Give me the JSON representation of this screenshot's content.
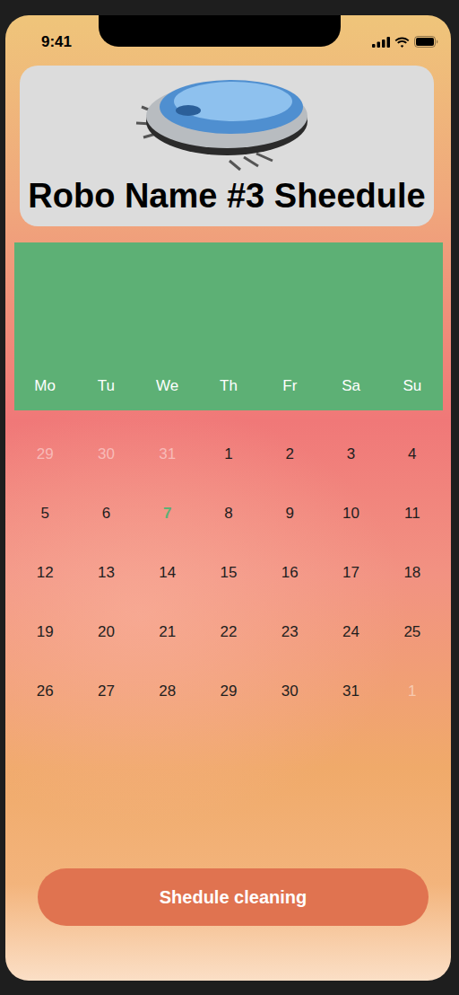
{
  "status_bar": {
    "time": "9:41"
  },
  "header": {
    "title": "Robo Name #3 Sheedule"
  },
  "calendar": {
    "weekdays": [
      "Mo",
      "Tu",
      "We",
      "Th",
      "Fr",
      "Sa",
      "Su"
    ],
    "days": [
      {
        "label": "29",
        "muted": true,
        "selected": false
      },
      {
        "label": "30",
        "muted": true,
        "selected": false
      },
      {
        "label": "31",
        "muted": true,
        "selected": false
      },
      {
        "label": "1",
        "muted": false,
        "selected": false
      },
      {
        "label": "2",
        "muted": false,
        "selected": false
      },
      {
        "label": "3",
        "muted": false,
        "selected": false
      },
      {
        "label": "4",
        "muted": false,
        "selected": false
      },
      {
        "label": "5",
        "muted": false,
        "selected": false
      },
      {
        "label": "6",
        "muted": false,
        "selected": false
      },
      {
        "label": "7",
        "muted": false,
        "selected": true
      },
      {
        "label": "8",
        "muted": false,
        "selected": false
      },
      {
        "label": "9",
        "muted": false,
        "selected": false
      },
      {
        "label": "10",
        "muted": false,
        "selected": false
      },
      {
        "label": "11",
        "muted": false,
        "selected": false
      },
      {
        "label": "12",
        "muted": false,
        "selected": false
      },
      {
        "label": "13",
        "muted": false,
        "selected": false
      },
      {
        "label": "14",
        "muted": false,
        "selected": false
      },
      {
        "label": "15",
        "muted": false,
        "selected": false
      },
      {
        "label": "16",
        "muted": false,
        "selected": false
      },
      {
        "label": "17",
        "muted": false,
        "selected": false
      },
      {
        "label": "18",
        "muted": false,
        "selected": false
      },
      {
        "label": "19",
        "muted": false,
        "selected": false
      },
      {
        "label": "20",
        "muted": false,
        "selected": false
      },
      {
        "label": "21",
        "muted": false,
        "selected": false
      },
      {
        "label": "22",
        "muted": false,
        "selected": false
      },
      {
        "label": "23",
        "muted": false,
        "selected": false
      },
      {
        "label": "24",
        "muted": false,
        "selected": false
      },
      {
        "label": "25",
        "muted": false,
        "selected": false
      },
      {
        "label": "26",
        "muted": false,
        "selected": false
      },
      {
        "label": "27",
        "muted": false,
        "selected": false
      },
      {
        "label": "28",
        "muted": false,
        "selected": false
      },
      {
        "label": "29",
        "muted": false,
        "selected": false
      },
      {
        "label": "30",
        "muted": false,
        "selected": false
      },
      {
        "label": "31",
        "muted": false,
        "selected": false
      },
      {
        "label": "1",
        "muted": true,
        "selected": false
      }
    ]
  },
  "button": {
    "label": "Shedule cleaning"
  }
}
